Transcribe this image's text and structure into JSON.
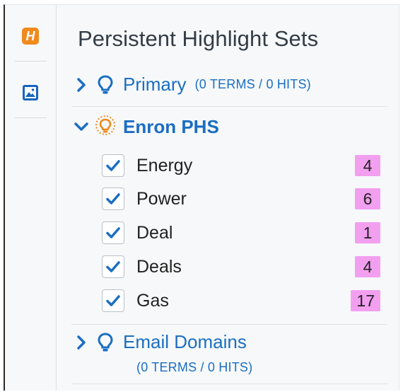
{
  "panel": {
    "title": "Persistent Highlight Sets"
  },
  "rail": {
    "items": [
      {
        "icon": "highlight-h-icon",
        "letter": "H",
        "color": "#f08a1c"
      },
      {
        "icon": "image-icon",
        "color": "#1565c0"
      }
    ]
  },
  "sets": [
    {
      "name": "Primary",
      "count": "(0 TERMS / 0 HITS)",
      "expanded": false,
      "active": false
    },
    {
      "name": "Enron PHS",
      "count": "",
      "expanded": true,
      "active": true,
      "terms": [
        {
          "label": "Energy",
          "checked": true,
          "hits": "4"
        },
        {
          "label": "Power",
          "checked": true,
          "hits": "6"
        },
        {
          "label": "Deal",
          "checked": true,
          "hits": "1"
        },
        {
          "label": "Deals",
          "checked": true,
          "hits": "4"
        },
        {
          "label": "Gas",
          "checked": true,
          "hits": "17"
        }
      ]
    },
    {
      "name": "Email Domains",
      "count": "(0 TERMS / 0 HITS)",
      "expanded": false,
      "active": false
    }
  ],
  "colors": {
    "link_blue": "#1b6ec2",
    "hit_badge": "#f29ff0",
    "active_bulb": "#f08a1c",
    "rail_accent": "#1565c0"
  }
}
